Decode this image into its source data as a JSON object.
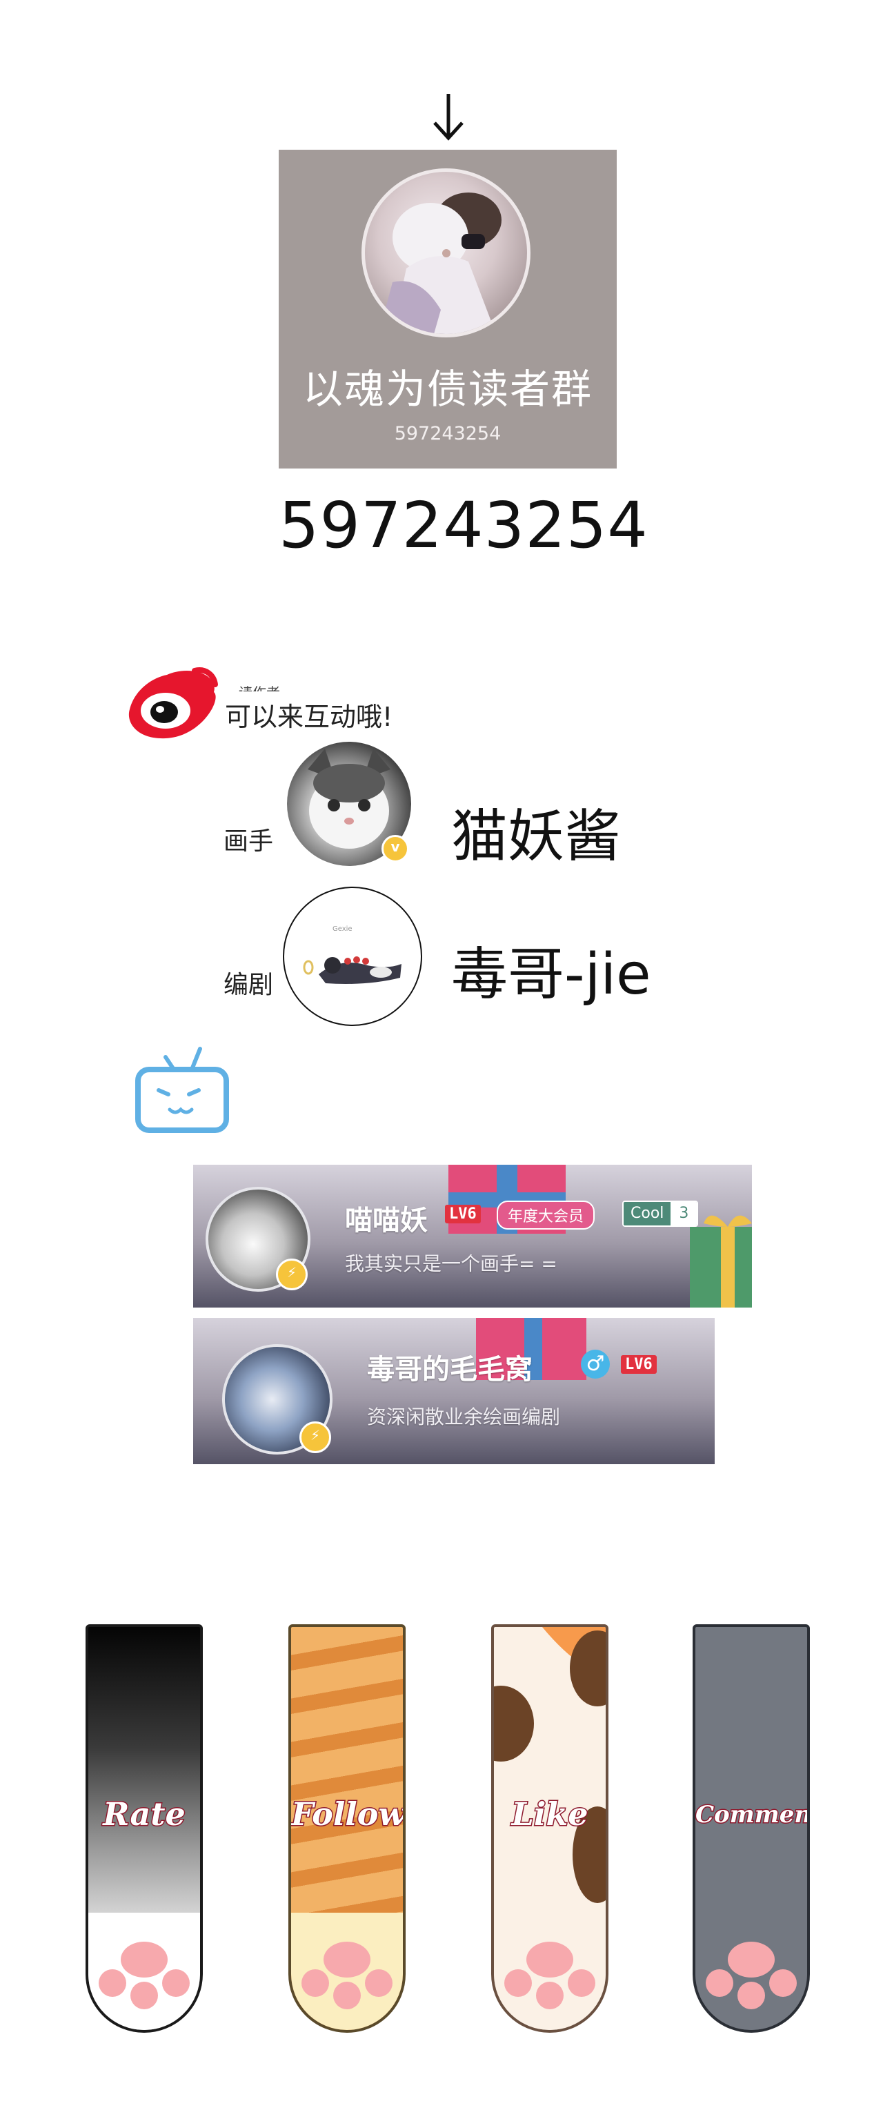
{
  "qq_group": {
    "name": "以魂为债读者群",
    "number_small": "597243254",
    "number_big": "597243254"
  },
  "weibo": {
    "caption_cut": "…请作者…",
    "caption": "可以来互动哦!",
    "artists": [
      {
        "role": "画手",
        "name": "猫妖酱",
        "verified": true
      },
      {
        "role": "编剧",
        "name": "毒哥-jie"
      }
    ],
    "drawing_signature": "Gexie"
  },
  "bilibili": {
    "cards": [
      {
        "name": "喵喵妖",
        "level": "LV6",
        "vip": "年度大会员",
        "cool_label": "Cool",
        "cool_count": "3",
        "sign": "我其实只是一个画手= ="
      },
      {
        "name": "毒哥的毛毛窝",
        "gender": "♂",
        "level": "LV6",
        "sign": "资深闲散业余绘画编剧"
      }
    ]
  },
  "paw_buttons": [
    {
      "label": "Rate",
      "theme": "black"
    },
    {
      "label": "Follow",
      "theme": "orange-tabby"
    },
    {
      "label": "Like",
      "theme": "calico"
    },
    {
      "label": "Comment",
      "theme": "grey"
    }
  ],
  "colors": {
    "qq_card_bg": "#a39b99",
    "weibo_red": "#e6162d",
    "bili_blue": "#5fb0e4",
    "paw_pink": "#f7a9ad",
    "label_outline": "#8e1a2e"
  }
}
